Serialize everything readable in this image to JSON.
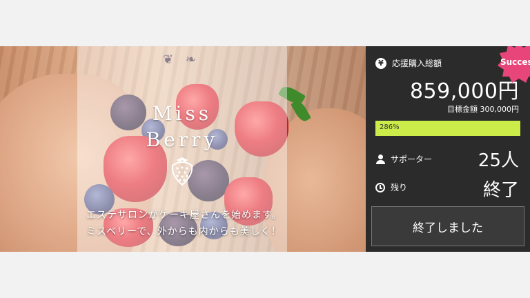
{
  "hero": {
    "logo_line1": "Miss",
    "logo_line2": "Berry",
    "caption_line1": "エステサロンがケーキ屋さんを始めます。",
    "caption_line2": "ミスベリーで、外からも内からも美しく！"
  },
  "panel": {
    "amount_label": "応援購入総額",
    "amount": "859,000円",
    "target": "目標金額 300,000円",
    "progress_text": "286%",
    "progress_value": 2.86,
    "supporters_label": "サポーター",
    "supporters_value": "25人",
    "remaining_label": "残り",
    "remaining_value": "終了",
    "end_button": "終了しました",
    "badge": "Success"
  },
  "colors": {
    "panel_bg": "#2b2b2b",
    "progress": "#ccec4a",
    "badge": "#e8457a"
  }
}
